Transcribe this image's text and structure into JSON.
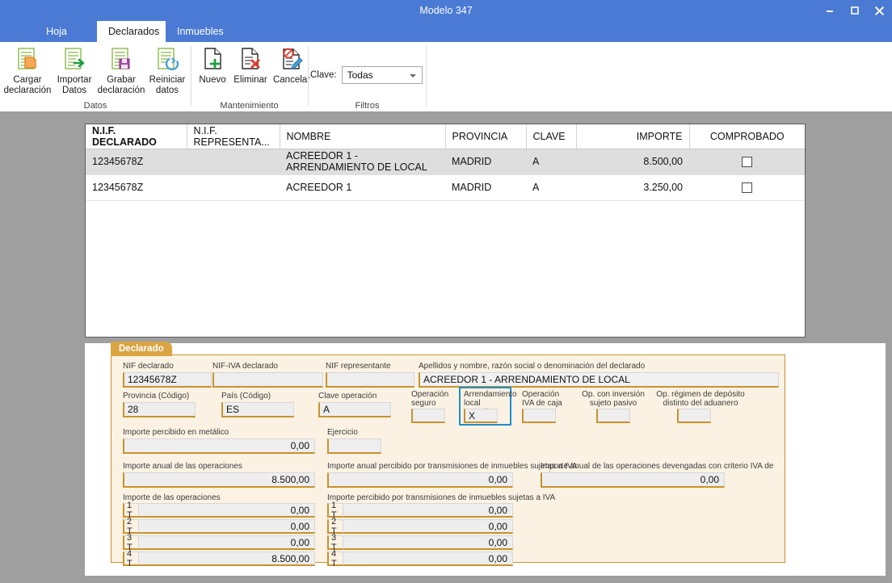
{
  "window": {
    "title": "Modelo 347",
    "minimize_label": "–",
    "maximize_label": "□",
    "close_label": "✕"
  },
  "tabs": [
    {
      "label": "Hoja resumen",
      "active": false
    },
    {
      "label": "Declarados",
      "active": true
    },
    {
      "label": "Inmuebles",
      "active": false
    }
  ],
  "ribbon": {
    "groups": [
      {
        "label": "Datos"
      },
      {
        "label": "Mantenimiento"
      },
      {
        "label": "Filtros"
      }
    ],
    "buttons": [
      {
        "label": "Cargar\ndeclaración",
        "icon": "load-declaration-icon"
      },
      {
        "label": "Importar\nDatos",
        "icon": "import-data-icon"
      },
      {
        "label": "Grabar\ndeclaración",
        "icon": "save-declaration-icon"
      },
      {
        "label": "Reiniciar\ndatos",
        "icon": "reset-data-icon"
      },
      {
        "label": "Nuevo",
        "icon": "new-document-icon"
      },
      {
        "label": "Eliminar",
        "icon": "delete-document-icon"
      },
      {
        "label": "Cancelar",
        "icon": "cancel-edit-icon"
      }
    ],
    "filter": {
      "label": "Clave:",
      "value": "Todas"
    }
  },
  "grid": {
    "columns": [
      {
        "key": "nif",
        "label": "N.I.F. DECLARADO",
        "sorted": true
      },
      {
        "key": "nif_rep",
        "label": "N.I.F. REPRESENTA..."
      },
      {
        "key": "nombre",
        "label": "NOMBRE"
      },
      {
        "key": "provincia",
        "label": "PROVINCIA"
      },
      {
        "key": "clave",
        "label": "CLAVE"
      },
      {
        "key": "importe",
        "label": "IMPORTE"
      },
      {
        "key": "comprobado",
        "label": "COMPROBADO"
      }
    ],
    "rows": [
      {
        "nif": "12345678Z",
        "nif_rep": "",
        "nombre": "ACREEDOR 1 - ARRENDAMIENTO DE LOCAL",
        "provincia": "MADRID",
        "clave": "A",
        "importe": "8.500,00",
        "comprobado": false,
        "selected": true
      },
      {
        "nif": "12345678Z",
        "nif_rep": "",
        "nombre": "ACREEDOR 1",
        "provincia": "MADRID",
        "clave": "A",
        "importe": "3.250,00",
        "comprobado": false,
        "selected": false
      }
    ]
  },
  "detail": {
    "tab_label": "Declarado",
    "fields": {
      "nif_declarado": {
        "label": "NIF declarado",
        "value": "12345678Z"
      },
      "nif_iva_declarado": {
        "label": "NIF-IVA declarado",
        "value": ""
      },
      "nif_representante": {
        "label": "NIF representante",
        "value": ""
      },
      "apellidos": {
        "label": "Apellidos y nombre, razón social o denominación del declarado",
        "value": "ACREEDOR 1 - ARRENDAMIENTO DE LOCAL"
      },
      "provincia_codigo": {
        "label": "Provincia (Código)",
        "value": "28"
      },
      "pais_codigo": {
        "label": "País (Código)",
        "value": "ES"
      },
      "clave_operacion": {
        "label": "Clave operación",
        "value": "A"
      },
      "operacion_seguro": {
        "label": "Operación\nseguro",
        "value": ""
      },
      "arrendamiento_local": {
        "label": "Arrendamiento\nlocal negocio",
        "value": "X",
        "highlighted": true
      },
      "operacion_iva_caja": {
        "label": "Operación\nIVA de caja",
        "value": ""
      },
      "op_inversion_sujeto_pasivo": {
        "label": "Op. con inversión\nsujeto pasivo",
        "value": ""
      },
      "op_regimen_deposito": {
        "label": "Op. régimen de depósito\ndistinto del aduanero",
        "value": ""
      },
      "importe_metalico": {
        "label": "Importe percibido en metálico",
        "value": "0,00"
      },
      "ejercicio": {
        "label": "Ejercicio",
        "value": ""
      },
      "importe_anual_operaciones": {
        "label": "Importe anual de las operaciones",
        "value": "8.500,00"
      },
      "importe_anual_transmisiones": {
        "label": "Importe anual percibido por transmisiones de inmuebles sujetas a IVA",
        "value": "0,00"
      },
      "importe_anual_devengadas_iva_caja": {
        "label": "Importe anual de las operaciones devengadas con criterio IVA de caja",
        "value": "0,00"
      }
    },
    "quarterly_left": {
      "label": "Importe de las operaciones",
      "rows": [
        {
          "period": "1 T",
          "value": "0,00"
        },
        {
          "period": "2 T",
          "value": "0,00"
        },
        {
          "period": "3 T",
          "value": "0,00"
        },
        {
          "period": "4 T",
          "value": "8.500,00"
        }
      ]
    },
    "quarterly_right": {
      "label": "Importe percibido por transmisiones de inmuebles sujetas a IVA",
      "rows": [
        {
          "period": "1 T",
          "value": "0,00"
        },
        {
          "period": "2 T",
          "value": "0,00"
        },
        {
          "period": "3 T",
          "value": "0,00"
        },
        {
          "period": "4 T",
          "value": "0,00"
        }
      ]
    }
  },
  "colors": {
    "titlebar": "#4a7ad4",
    "accent_orange": "#c8922e",
    "form_bg": "#fbf2e3",
    "highlight_blue": "#1d8ecd",
    "desktop_gray": "#9f9f9f"
  }
}
